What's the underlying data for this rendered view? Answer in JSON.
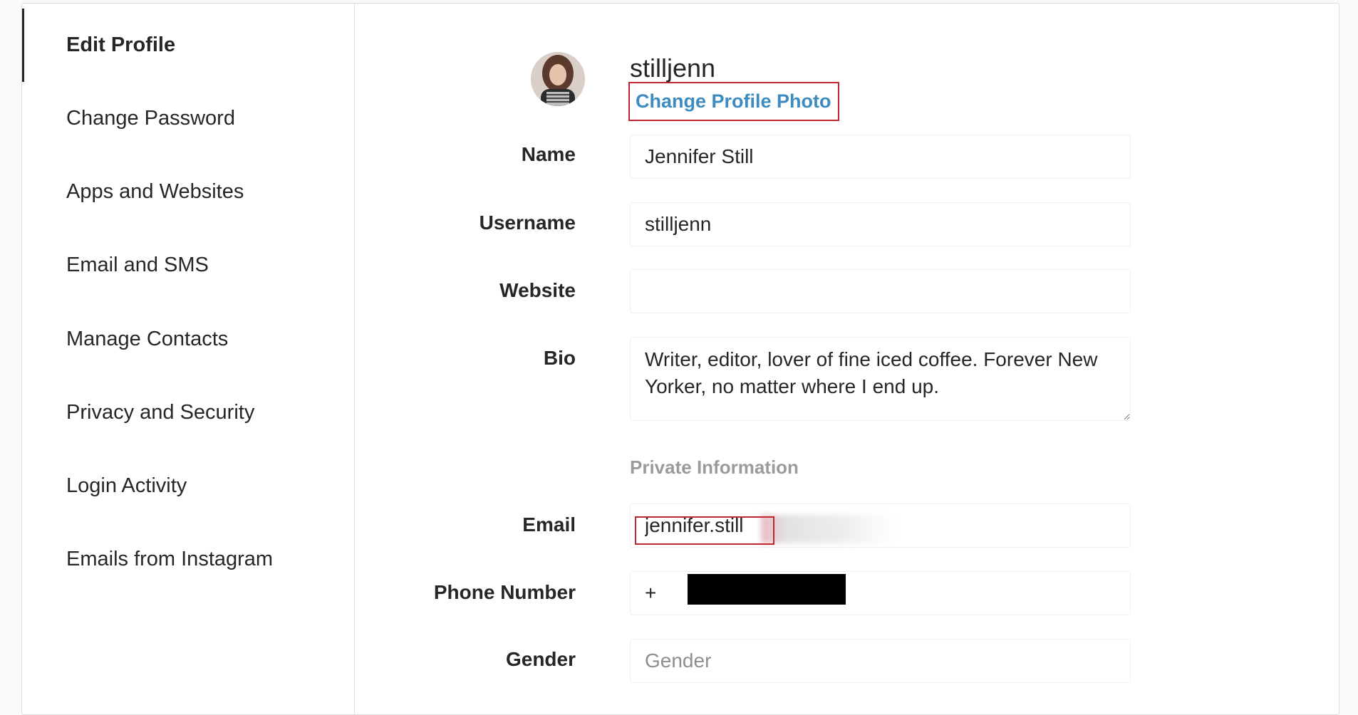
{
  "sidebar": {
    "items": [
      {
        "label": "Edit Profile",
        "active": true
      },
      {
        "label": "Change Password"
      },
      {
        "label": "Apps and Websites"
      },
      {
        "label": "Email and SMS"
      },
      {
        "label": "Manage Contacts"
      },
      {
        "label": "Privacy and Security"
      },
      {
        "label": "Login Activity"
      },
      {
        "label": "Emails from Instagram"
      }
    ]
  },
  "profile": {
    "username": "stilljenn",
    "change_photo_label": "Change Profile Photo"
  },
  "form": {
    "name": {
      "label": "Name",
      "value": "Jennifer Still"
    },
    "username": {
      "label": "Username",
      "value": "stilljenn"
    },
    "website": {
      "label": "Website",
      "value": ""
    },
    "bio": {
      "label": "Bio",
      "value": "Writer, editor, lover of fine iced coffee. Forever New Yorker, no matter where I end up."
    },
    "private_title": "Private Information",
    "email": {
      "label": "Email",
      "value": "jennifer.still"
    },
    "phone": {
      "label": "Phone Number",
      "value": "+"
    },
    "gender": {
      "label": "Gender",
      "placeholder": "Gender",
      "value": ""
    }
  },
  "colors": {
    "link_blue": "#3d8bc0",
    "highlight_red": "#c0262d",
    "border": "#dbdbdb"
  }
}
